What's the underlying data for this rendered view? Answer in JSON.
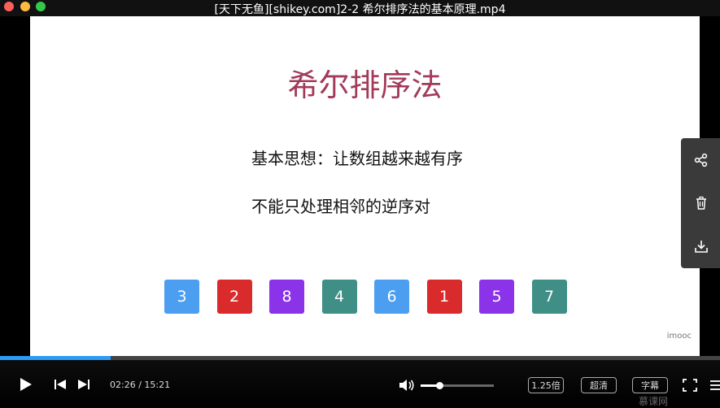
{
  "window": {
    "title": "[天下无鱼][shikey.com]2-2 希尔排序法的基本原理.mp4"
  },
  "slide": {
    "title": "希尔排序法",
    "line1": "基本思想：让数组越来越有序",
    "line2": "不能只处理相邻的逆序对",
    "cells": [
      {
        "value": "3",
        "color": "#4b9ef0"
      },
      {
        "value": "2",
        "color": "#d92b2b"
      },
      {
        "value": "8",
        "color": "#8a33e8"
      },
      {
        "value": "4",
        "color": "#3f8f87"
      },
      {
        "value": "6",
        "color": "#4b9ef0"
      },
      {
        "value": "1",
        "color": "#d92b2b"
      },
      {
        "value": "5",
        "color": "#8a33e8"
      },
      {
        "value": "7",
        "color": "#3f8f87"
      }
    ],
    "watermark": "imooc"
  },
  "side_panel": {
    "icons": [
      "share-icon",
      "trash-icon",
      "download-icon"
    ]
  },
  "player": {
    "current_time": "02:26",
    "duration": "15:21",
    "time_display": "02:26 / 15:21",
    "progress_fraction": 0.154,
    "volume_fraction": 0.26,
    "speed_label": "1.25倍",
    "quality_label": "超清",
    "subtitle_label": "字幕",
    "brand": "慕课网",
    "colors": {
      "progress": "#2b9bf4"
    }
  }
}
